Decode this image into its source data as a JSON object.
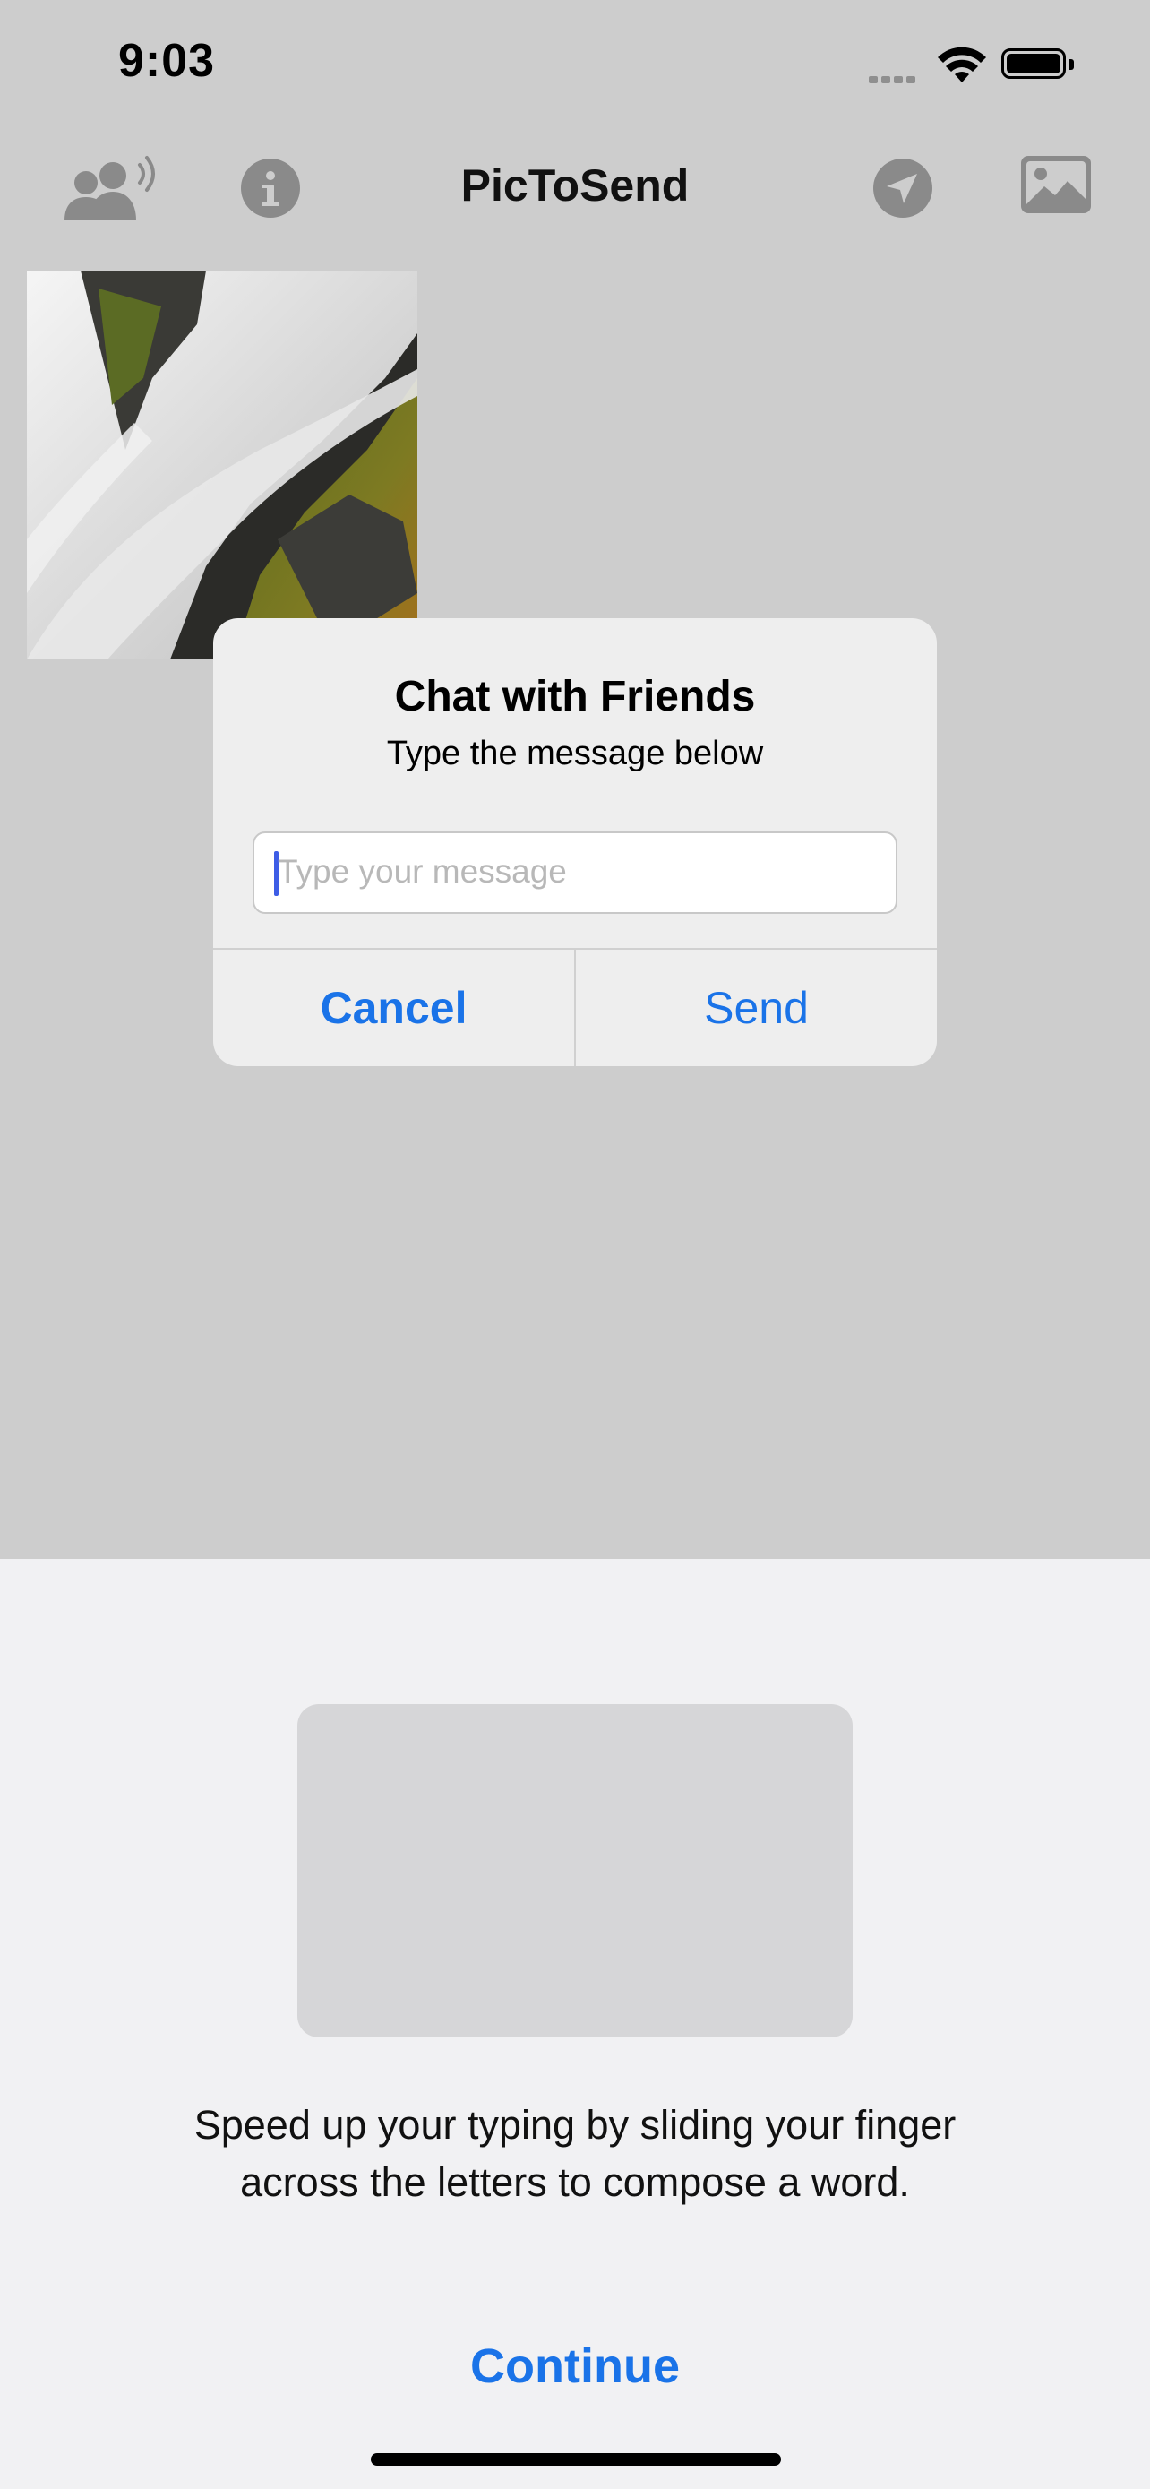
{
  "status_bar": {
    "time": "9:03"
  },
  "nav": {
    "title": "PicToSend",
    "icons": [
      "people-speaking-icon",
      "info-icon",
      "send-location-icon",
      "photo-icon"
    ]
  },
  "alert": {
    "title": "Chat with Friends",
    "message": "Type the message below",
    "input_placeholder": "Type your message",
    "input_value": "",
    "cancel_label": "Cancel",
    "send_label": "Send"
  },
  "swipe_sheet": {
    "line1": "Speed up your typing by sliding your finger",
    "line2": "across the letters to compose a word.",
    "continue_label": "Continue"
  },
  "colors": {
    "accent": "#1a73e8",
    "dim_overlay": "#cdcdcd",
    "icon_gray": "#8a8a8a"
  }
}
